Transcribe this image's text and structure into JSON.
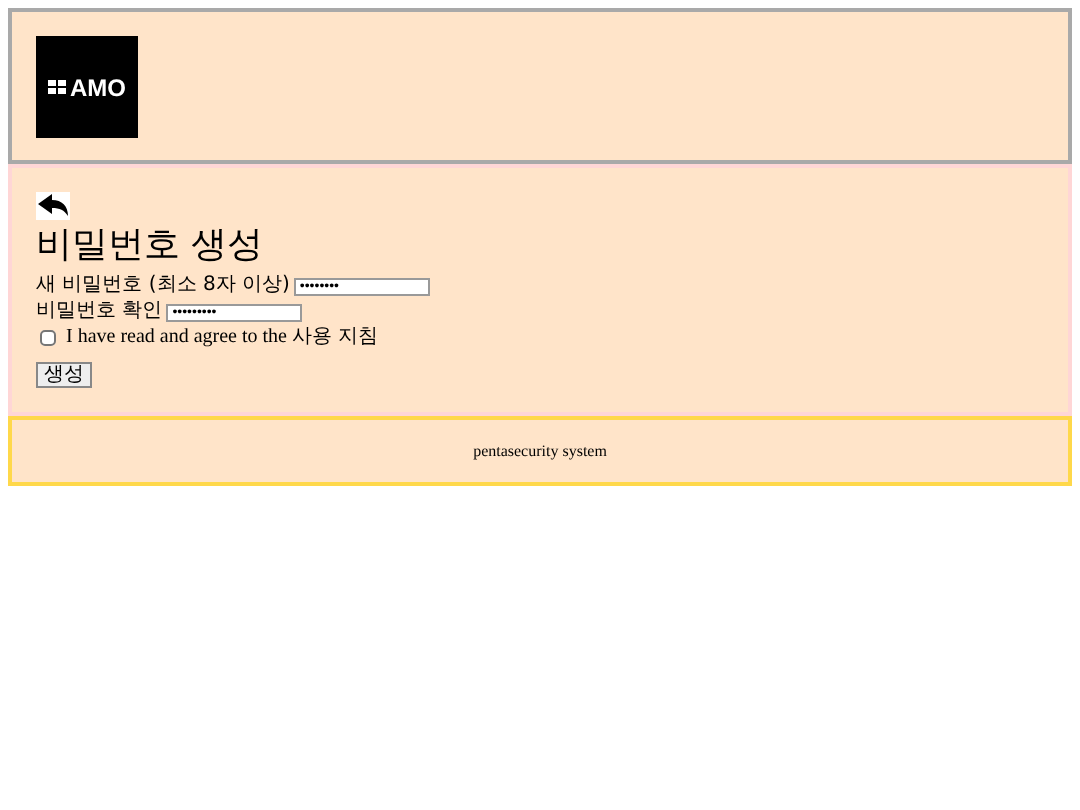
{
  "header": {
    "logo": {
      "text": "AMO"
    }
  },
  "main": {
    "title": "비밀번호 생성",
    "fields": [
      {
        "label": "새 비밀번호 (최소 8자 이상)",
        "value": "••••••••"
      },
      {
        "label": "비밀번호 확인",
        "value": "•••••••••"
      }
    ],
    "agree": {
      "checked": false,
      "text": "I have read and agree to the",
      "link": "사용 지침"
    },
    "button": "생성"
  },
  "footer": {
    "text": "pentasecurity system"
  }
}
